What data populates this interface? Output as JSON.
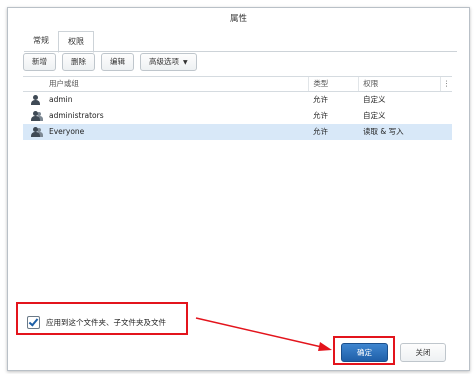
{
  "window": {
    "title": "属性"
  },
  "tabs": [
    {
      "label": "常规"
    },
    {
      "label": "权限"
    }
  ],
  "toolbar": {
    "new": "新增",
    "delete": "删除",
    "edit": "编辑",
    "advanced": "高级选项"
  },
  "grid": {
    "headers": {
      "user": "用户或组",
      "type": "类型",
      "permission": "权限",
      "more": "⋮"
    },
    "rows": [
      {
        "name": "admin",
        "type": "允许",
        "permission": "自定义",
        "icon": "user-icon"
      },
      {
        "name": "administrators",
        "type": "允许",
        "permission": "自定义",
        "icon": "group-icon"
      },
      {
        "name": "Everyone",
        "type": "允许",
        "permission": "读取 & 写入",
        "icon": "group-icon"
      }
    ]
  },
  "apply_checkbox": {
    "label": "应用到这个文件夹、子文件夹及文件",
    "checked": true
  },
  "footer": {
    "ok": "确定",
    "close": "关闭"
  },
  "colors": {
    "annotation": "#e3141c",
    "primary": "#2a6fb8",
    "selected_row": "#d8e8f8"
  }
}
